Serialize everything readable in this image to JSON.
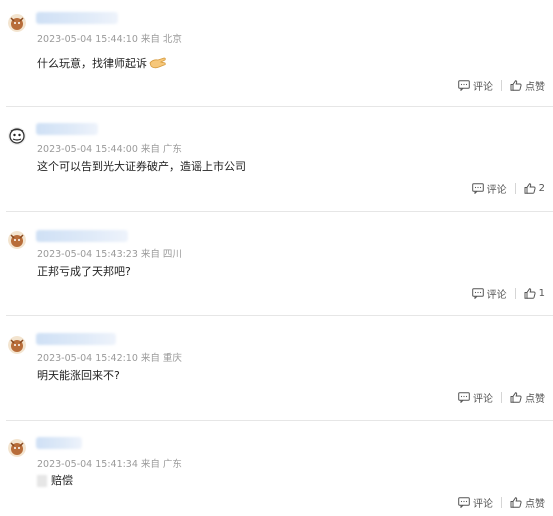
{
  "comments": [
    {
      "timestamp": "2023-05-04 15:44:10",
      "from_label": "来自",
      "location": "北京",
      "text": "什么玩意，找律师起诉",
      "reply_label": "评论",
      "like_label": "点赞"
    },
    {
      "timestamp": "2023-05-04 15:44:00",
      "from_label": "来自",
      "location": "广东",
      "text": "这个可以告到光大证券破产，造谣上市公司",
      "reply_label": "评论",
      "like_label": "2"
    },
    {
      "timestamp": "2023-05-04 15:43:23",
      "from_label": "来自",
      "location": "四川",
      "text": "正邦亏成了天邦吧?",
      "reply_label": "评论",
      "like_label": "1"
    },
    {
      "timestamp": "2023-05-04 15:42:10",
      "from_label": "来自",
      "location": "重庆",
      "text": "明天能涨回来不?",
      "reply_label": "评论",
      "like_label": "点赞"
    },
    {
      "timestamp": "2023-05-04 15:41:34",
      "from_label": "来自",
      "location": "广东",
      "text": "赔偿",
      "reply_label": "评论",
      "like_label": "点赞"
    }
  ],
  "icons": {
    "reply": "comment-icon",
    "like": "thumbs-up-icon",
    "emoji": "hand-emoji-icon"
  },
  "colors": {
    "meta": "#9a9a9a",
    "divider": "#e6e6e6",
    "name_blur": "#cfe0f5"
  }
}
